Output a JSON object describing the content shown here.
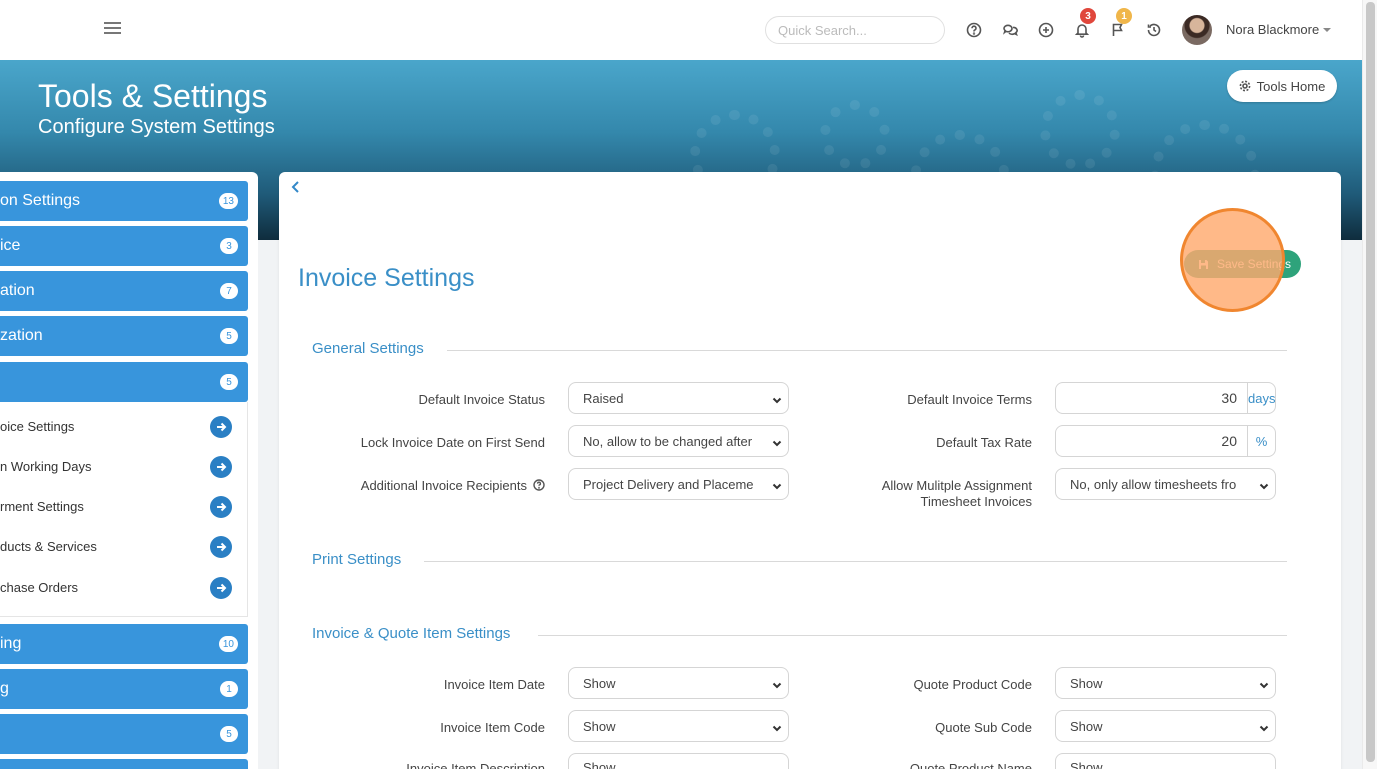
{
  "topbar": {
    "search_placeholder": "Quick Search...",
    "notifications_count": "3",
    "flags_count": "1",
    "user_name": "Nora Blackmore"
  },
  "banner": {
    "title": "Tools & Settings",
    "subtitle": "Configure System Settings",
    "tools_home_label": "Tools Home"
  },
  "sidebar": {
    "items": [
      {
        "label": "on Settings",
        "count": "13"
      },
      {
        "label": "ice",
        "count": "3"
      },
      {
        "label": "ation",
        "count": "7"
      },
      {
        "label": "zation",
        "count": "5"
      },
      {
        "label": "",
        "count": "5"
      },
      {
        "label": "ing",
        "count": "10"
      },
      {
        "label": "g",
        "count": "1"
      },
      {
        "label": "",
        "count": "5"
      }
    ],
    "subitems": [
      {
        "label": "oice Settings"
      },
      {
        "label": "n Working Days"
      },
      {
        "label": "rment Settings"
      },
      {
        "label": "ducts & Services"
      },
      {
        "label": "chase Orders"
      }
    ]
  },
  "main": {
    "title": "Invoice Settings",
    "save_label": "Save Settings",
    "sections": {
      "general": "General Settings",
      "print": "Print Settings",
      "items": "Invoice & Quote Item Settings"
    },
    "general": {
      "default_invoice_status_label": "Default Invoice Status",
      "default_invoice_status_value": "Raised",
      "lock_invoice_date_label": "Lock Invoice Date on First Send",
      "lock_invoice_date_value": "No, allow to be changed after",
      "additional_recipients_label": "Additional Invoice Recipients",
      "additional_recipients_value": "Project Delivery and Placeme",
      "default_terms_label": "Default Invoice Terms",
      "default_terms_value": "30",
      "default_terms_unit": "days",
      "default_tax_label": "Default Tax Rate",
      "default_tax_value": "20",
      "default_tax_unit": "%",
      "allow_multiple_label_1": "Allow Mulitple Assignment",
      "allow_multiple_label_2": "Timesheet Invoices",
      "allow_multiple_value": "No, only allow timesheets fro"
    },
    "item_settings": {
      "invoice_item_date_label": "Invoice Item Date",
      "invoice_item_date_value": "Show",
      "invoice_item_code_label": "Invoice Item Code",
      "invoice_item_code_value": "Show",
      "invoice_item_desc_label": "Invoice Item Description",
      "invoice_item_desc_value": "Show",
      "quote_product_code_label": "Quote Product Code",
      "quote_product_code_value": "Show",
      "quote_sub_code_label": "Quote Sub Code",
      "quote_sub_code_value": "Show",
      "quote_product_name_label": "Quote Product Name",
      "quote_product_name_value": "Show"
    }
  }
}
